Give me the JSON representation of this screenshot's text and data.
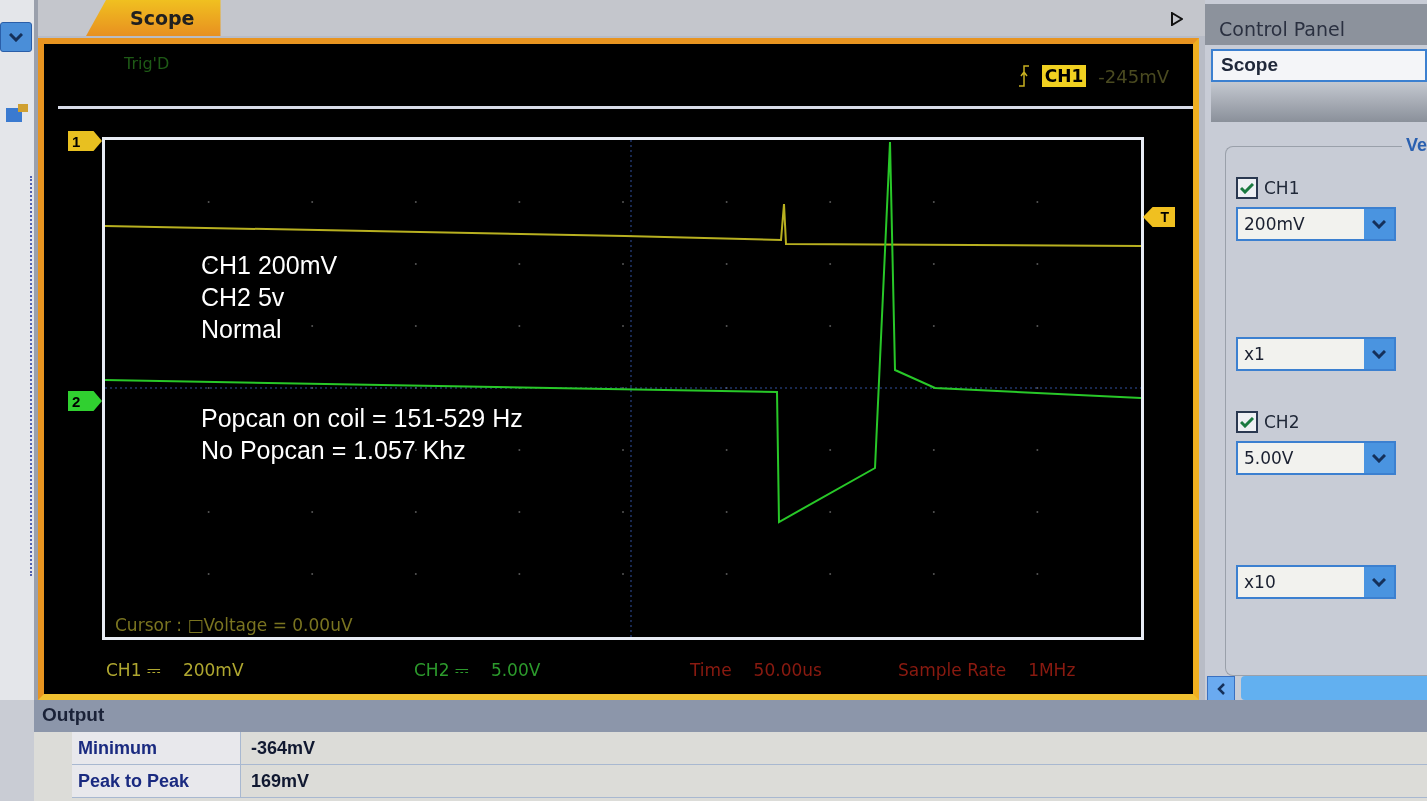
{
  "tabs": [
    {
      "label": "Scope",
      "selected": true
    }
  ],
  "scope": {
    "trigger_status": "Trig'D",
    "trigger_channel": "CH1",
    "trigger_level": "-245mV",
    "markers": [
      {
        "label": "1",
        "color": "#e8c020"
      },
      {
        "label": "2",
        "color": "#30d030"
      }
    ],
    "trigger_marker": "T",
    "annotation": [
      [
        "CH1 200mV",
        "CH2 5v",
        "Normal"
      ],
      [
        "Popcan on coil = 151-529 Hz",
        "No Popcan = 1.057 Khz"
      ]
    ],
    "cursor_readout": "Cursor : □Voltage = 0.00uV",
    "status": [
      {
        "label": "CH1 ⎓",
        "value": "200mV",
        "color": "#b0a830"
      },
      {
        "label": "CH2 ⎓",
        "value": "5.00V",
        "color": "#2c9a2c"
      },
      {
        "label": "Time",
        "value": "50.00us",
        "color": "#8a1a10"
      },
      {
        "label": "Sample Rate",
        "value": "1MHz",
        "color": "#8a1a10"
      }
    ]
  },
  "control_panel": {
    "title": "Control Panel",
    "section": "Scope",
    "group_title": "Ve",
    "channels": [
      {
        "label": "CH1",
        "checked": true,
        "volts": "200mV",
        "probe": "x1"
      },
      {
        "label": "CH2",
        "checked": true,
        "volts": "5.00V",
        "probe": "x10"
      }
    ]
  },
  "output": {
    "title": "Output",
    "rows": [
      {
        "name": "Minimum",
        "value": "-364mV"
      },
      {
        "name": "Peak to Peak",
        "value": "169mV"
      }
    ]
  }
}
